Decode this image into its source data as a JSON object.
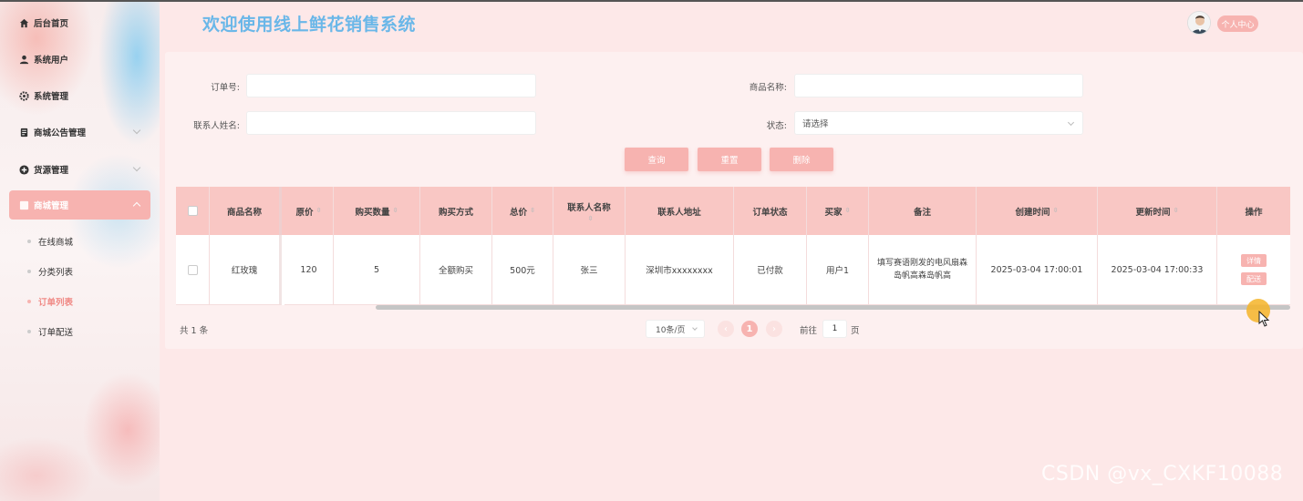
{
  "header": {
    "title": "欢迎使用线上鲜花销售系统",
    "profile_label": "个人中心"
  },
  "sidebar": {
    "items": [
      {
        "label": "后台首页",
        "icon": "home-icon"
      },
      {
        "label": "系统用户",
        "icon": "user-icon"
      },
      {
        "label": "系统管理",
        "icon": "gear-icon"
      },
      {
        "label": "商城公告管理",
        "icon": "document-icon"
      },
      {
        "label": "货源管理",
        "icon": "add-circle-icon"
      },
      {
        "label": "商城管理",
        "icon": "shop-icon"
      }
    ],
    "sub_items": [
      {
        "label": "在线商城"
      },
      {
        "label": "分类列表"
      },
      {
        "label": "订单列表"
      },
      {
        "label": "订单配送"
      }
    ]
  },
  "search": {
    "order_no_label": "订单号:",
    "order_no_value": "",
    "product_name_label": "商品名称:",
    "product_name_value": "",
    "contact_name_label": "联系人姓名:",
    "contact_name_value": "",
    "status_label": "状态:",
    "status_value": "请选择",
    "query_btn": "查询",
    "reset_btn": "重置",
    "delete_btn": "删除"
  },
  "table": {
    "columns": [
      "商品名称",
      "原价",
      "购买数量",
      "购买方式",
      "总价",
      "联系人名称",
      "联系人地址",
      "订单状态",
      "买家",
      "备注",
      "创建时间",
      "更新时间",
      "操作"
    ],
    "rows": [
      {
        "product": "红玫瑰",
        "price": "120",
        "quantity": "5",
        "method": "全额购买",
        "total": "500元",
        "contact": "张三",
        "address": "深圳市xxxxxxxx",
        "status": "已付款",
        "buyer": "用户1",
        "note": "填写赛语刚发的电风扇森岛帆高森岛帆高",
        "created": "2025-03-04 17:00:01",
        "updated": "2025-03-04 17:00:33",
        "detail_btn": "详情",
        "deliver_btn": "配送"
      }
    ]
  },
  "pagination": {
    "total": "共 1 条",
    "page_size": "10条/页",
    "current": "1",
    "prev": "‹",
    "next": "›",
    "goto_label": "前往",
    "goto_value": "1",
    "page_suffix": "页"
  },
  "watermark": "CSDN @vx_CXKF10088",
  "colors": {
    "accent": "#f7b3b0",
    "title": "#6ab7e8",
    "header_row": "#f9c7c4",
    "background": "#fde8e8"
  }
}
